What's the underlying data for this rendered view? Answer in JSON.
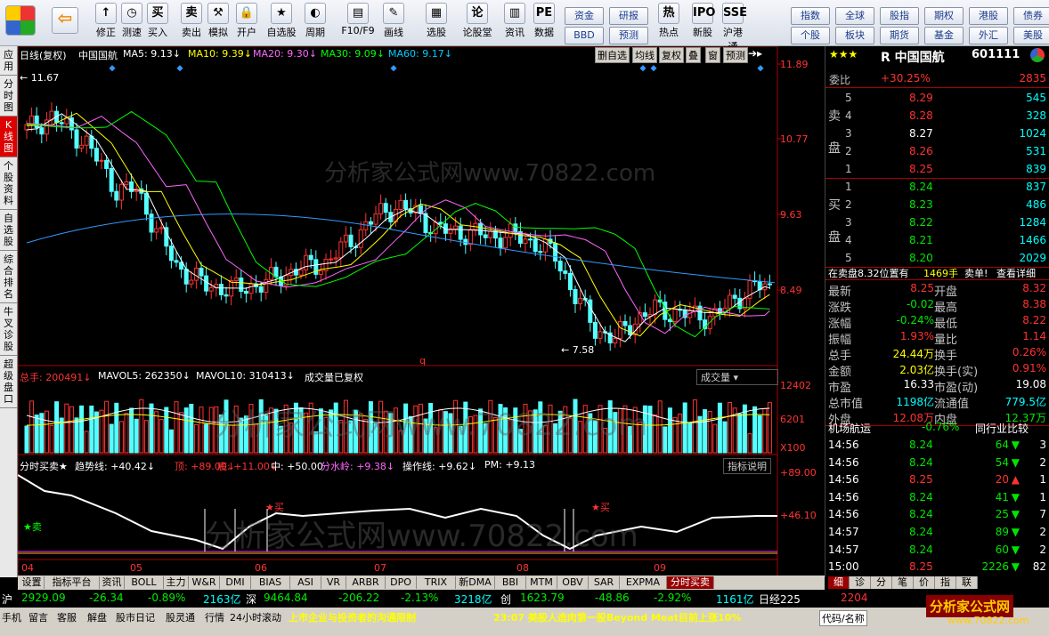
{
  "toolbar": {
    "buttons": [
      {
        "label": "修正",
        "icon": "↑"
      },
      {
        "label": "测速",
        "icon": "◷"
      },
      {
        "label": "买入",
        "icon": "买"
      },
      {
        "label": "卖出",
        "icon": "卖"
      },
      {
        "label": "模拟",
        "icon": "⚒"
      },
      {
        "label": "开户",
        "icon": "🔒"
      },
      {
        "label": "自选股",
        "icon": "★"
      },
      {
        "label": "周期",
        "icon": "◐"
      },
      {
        "label": "F10/F9",
        "icon": "▤"
      },
      {
        "label": "画线",
        "icon": "✎"
      },
      {
        "label": "选股",
        "icon": "▦"
      },
      {
        "label": "论股堂",
        "icon": "论"
      },
      {
        "label": "资讯",
        "icon": "▥"
      },
      {
        "label": "数据",
        "icon": "PE"
      },
      {
        "label": "热点",
        "icon": "热"
      },
      {
        "label": "新股",
        "icon": "IPO"
      },
      {
        "label": "沪港通",
        "icon": "SSE"
      }
    ],
    "grid": [
      "资金",
      "研报",
      "BBD",
      "预测",
      "指数",
      "全球",
      "股指",
      "期权",
      "港股",
      "债券",
      "个股",
      "板块",
      "期货",
      "基金",
      "外汇",
      "美股"
    ]
  },
  "leftnav": [
    "应用",
    "分时图",
    "K线图",
    "个股资料",
    "自选股",
    "综合排名",
    "牛叉诊股",
    "超级盘口"
  ],
  "header": {
    "period": "日线(复权)",
    "name": "中国国航",
    "ma": [
      {
        "t": "MA5: 9.13",
        "c": "#ffffff"
      },
      {
        "t": "MA10: 9.39",
        "c": "#ffff00"
      },
      {
        "t": "MA20: 9.30",
        "c": "#ff66ff"
      },
      {
        "t": "MA30: 9.09",
        "c": "#00ff00"
      },
      {
        "t": "MA60: 9.17",
        "c": "#00ccff"
      }
    ],
    "buttons": [
      "删自选",
      "均线",
      "复权",
      "叠",
      "窗",
      "预测"
    ]
  },
  "price_axis": [
    "11.89",
    "10.77",
    "9.63",
    "8.49"
  ],
  "annot": {
    "high": "11.67",
    "low": "7.58",
    "q": "q"
  },
  "watermark": "分析家公式网www.70822.com",
  "volume": {
    "total": "总手: 200491",
    "mav5": "MAVOL5: 262350",
    "mav10": "MAVOL10: 310413",
    "note": "成交量已复权",
    "dropdown": "成交量",
    "axis": [
      "12402",
      "6201",
      "X100"
    ]
  },
  "indicator": {
    "name": "分时买卖★",
    "trend": "趋势线: +40.42",
    "top": "顶: +89.00",
    "bottom": "底: +11.00",
    "mid": "中: +50.00",
    "water": "分水岭: +9.38",
    "op": "操作线: +9.62",
    "pm": "PM: +9.13",
    "btn": "指标说明",
    "axis": [
      "+89.00",
      "+46.10"
    ],
    "sell": "★卖",
    "buy": "★买"
  },
  "months": [
    "04",
    "05",
    "06",
    "07",
    "08",
    "09"
  ],
  "quote": {
    "stars": "★★★",
    "code": "R 中国国航",
    "num": "601111",
    "weibi": {
      "label": "委比",
      "pct": "+30.25%",
      "diff": "2835"
    },
    "sell": [
      [
        "5",
        "8.29",
        "545"
      ],
      [
        "4",
        "8.28",
        "328"
      ],
      [
        "3",
        "8.27",
        "1024"
      ],
      [
        "2",
        "8.26",
        "531"
      ],
      [
        "1",
        "8.25",
        "839"
      ]
    ],
    "sell_label": [
      "卖",
      "盘"
    ],
    "buy": [
      [
        "1",
        "8.24",
        "837"
      ],
      [
        "2",
        "8.23",
        "486"
      ],
      [
        "3",
        "8.22",
        "1284"
      ],
      [
        "4",
        "8.21",
        "1466"
      ],
      [
        "5",
        "8.20",
        "2029"
      ]
    ],
    "buy_label": [
      "买",
      "盘"
    ],
    "info": [
      "在卖盘8.32位置有",
      "1469手",
      "卖单!",
      "查看详细"
    ],
    "stats": [
      [
        "最新",
        "8.25",
        "开盘",
        "8.32"
      ],
      [
        "涨跌",
        "-0.02",
        "最高",
        "8.38"
      ],
      [
        "涨幅",
        "-0.24%",
        "最低",
        "8.22"
      ],
      [
        "振幅",
        "1.93%",
        "量比",
        "1.14"
      ],
      [
        "总手",
        "24.44万",
        "换手",
        "0.26%"
      ],
      [
        "金额",
        "2.03亿",
        "换手(实)",
        "0.91%"
      ],
      [
        "市盈",
        "16.33",
        "市盈(动)",
        "19.08"
      ],
      [
        "总市值",
        "1198亿",
        "流通值",
        "779.5亿"
      ],
      [
        "外盘",
        "12.08万",
        "内盘",
        "12.37万"
      ]
    ],
    "hangyun": [
      "机场航运",
      "-0.76%",
      "同行业比较"
    ],
    "ticks": [
      [
        "14:56",
        "8.24",
        "64",
        "down"
      ],
      [
        "14:56",
        "8.24",
        "54",
        "down"
      ],
      [
        "14:56",
        "8.25",
        "20",
        "up"
      ],
      [
        "14:56",
        "8.24",
        "41",
        "down"
      ],
      [
        "14:56",
        "8.24",
        "25",
        "down"
      ],
      [
        "14:57",
        "8.24",
        "89",
        "down"
      ],
      [
        "14:57",
        "8.24",
        "60",
        "down"
      ],
      [
        "15:00",
        "8.25",
        "2226",
        "down"
      ]
    ],
    "ticks_tail": [
      "3",
      "2",
      "1",
      "1",
      "7",
      "2",
      "2",
      "82"
    ]
  },
  "tabs": [
    "设置",
    "指标平台",
    "资讯",
    "BOLL",
    "主力",
    "W&R",
    "DMI",
    "BIAS",
    "ASI",
    "VR",
    "ARBR",
    "DPO",
    "TRIX",
    "新DMA",
    "BBI",
    "MTM",
    "OBV",
    "SAR",
    "EXPMA",
    "分时买卖★"
  ],
  "rtabs": [
    "细",
    "诊",
    "分",
    "笔",
    "价",
    "指",
    "联"
  ],
  "status": {
    "sh": "沪",
    "shv": "2929.09",
    "shc": "-26.34",
    "shp": "-0.89%",
    "sha": "2163亿",
    "sz": "深",
    "szv": "9464.84",
    "szc": "-206.22",
    "szp": "-2.13%",
    "sza": "3218亿",
    "cy": "创",
    "cyv": "1623.79",
    "cyc": "-48.86",
    "cyp": "-2.92%",
    "cya": "1161亿",
    "rj": "日经225",
    "rjv": "2204"
  },
  "bottom": {
    "items": [
      "手机",
      "留言",
      "客服",
      "解盘",
      "股市日记",
      "股灵通",
      "行情",
      "24小时滚动"
    ],
    "news1": "上市企业与投资者的沟通限制",
    "news2": "23:07 美股人造肉第一股Beyond Meat目前上涨10%",
    "code": "代码/名称",
    "logo": "分析家公式网",
    "logo2": "www.70822.com"
  }
}
